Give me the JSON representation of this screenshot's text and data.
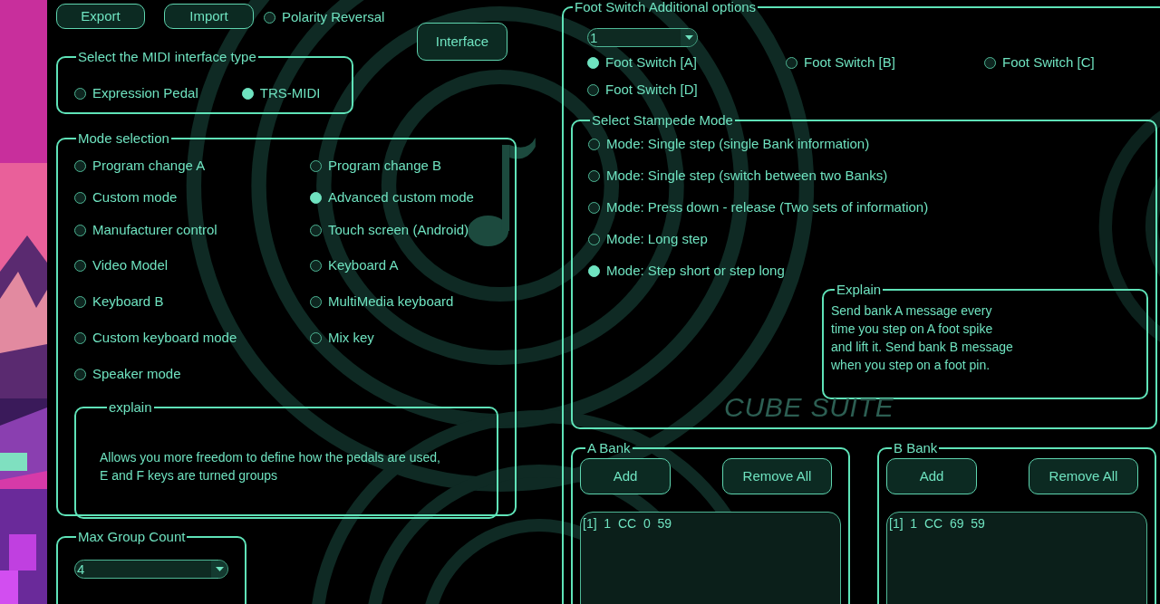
{
  "top_bar": {
    "buttons": [
      "Export",
      "Import"
    ],
    "polarity_reversal": {
      "label": "Polarity Reversal",
      "checked": false
    },
    "interface_button": "Interface"
  },
  "midi_interface": {
    "title": "Select the MIDI interface type",
    "options": [
      {
        "label": "Expression Pedal",
        "selected": false
      },
      {
        "label": "TRS-MIDI",
        "selected": true
      }
    ]
  },
  "mode_selection": {
    "title": "Mode selection",
    "options": [
      {
        "label": "Program change A",
        "selected": false
      },
      {
        "label": "Program change B",
        "selected": false
      },
      {
        "label": "Custom mode",
        "selected": false
      },
      {
        "label": "Advanced custom mode",
        "selected": true
      },
      {
        "label": "Manufacturer control",
        "selected": false
      },
      {
        "label": "Touch screen (Android)",
        "selected": false
      },
      {
        "label": "Video Model",
        "selected": false
      },
      {
        "label": "Keyboard A",
        "selected": false
      },
      {
        "label": "Keyboard B",
        "selected": false
      },
      {
        "label": "MultiMedia keyboard",
        "selected": false
      },
      {
        "label": "Custom keyboard mode",
        "selected": false
      },
      {
        "label": "Mix key",
        "selected": false
      },
      {
        "label": "Speaker mode",
        "selected": false
      }
    ],
    "explain": {
      "title": "explain",
      "text": "Allows you more freedom to define how the pedals are used,\nE and F keys are turned groups"
    }
  },
  "max_group_count": {
    "title": "Max Group Count",
    "value": "4"
  },
  "foot_switch": {
    "title": "Foot Switch Additional options",
    "value": "1",
    "switches": [
      {
        "label": "Foot Switch [A]",
        "selected": true
      },
      {
        "label": "Foot Switch [B]",
        "selected": false
      },
      {
        "label": "Foot Switch [C]",
        "selected": false
      },
      {
        "label": "Foot Switch [D]",
        "selected": false
      }
    ],
    "stampede_mode": {
      "title": "Select Stampede Mode",
      "options": [
        {
          "label": "Mode: Single step (single Bank information)",
          "selected": false
        },
        {
          "label": "Mode: Single step (switch between two Banks)",
          "selected": false
        },
        {
          "label": "Mode: Press down - release (Two sets of information)",
          "selected": false
        },
        {
          "label": "Mode: Long step",
          "selected": false
        },
        {
          "label": "Mode: Step short or step long",
          "selected": true
        }
      ],
      "explain": {
        "title": "Explain",
        "text": "Send bank A message every\ntime you step on A foot spike\nand lift it.  Send bank B message\nwhen you step on a foot pin."
      }
    },
    "logo_text": "CUBE SUITE",
    "banks": [
      {
        "title": "A Bank",
        "buttons": [
          "Add",
          "Remove All"
        ],
        "entries": [
          "[1]  1  CC  0  59"
        ]
      },
      {
        "title": "B Bank",
        "buttons": [
          "Add",
          "Remove All"
        ],
        "entries": [
          "[1]  1  CC  69  59"
        ]
      }
    ]
  }
}
